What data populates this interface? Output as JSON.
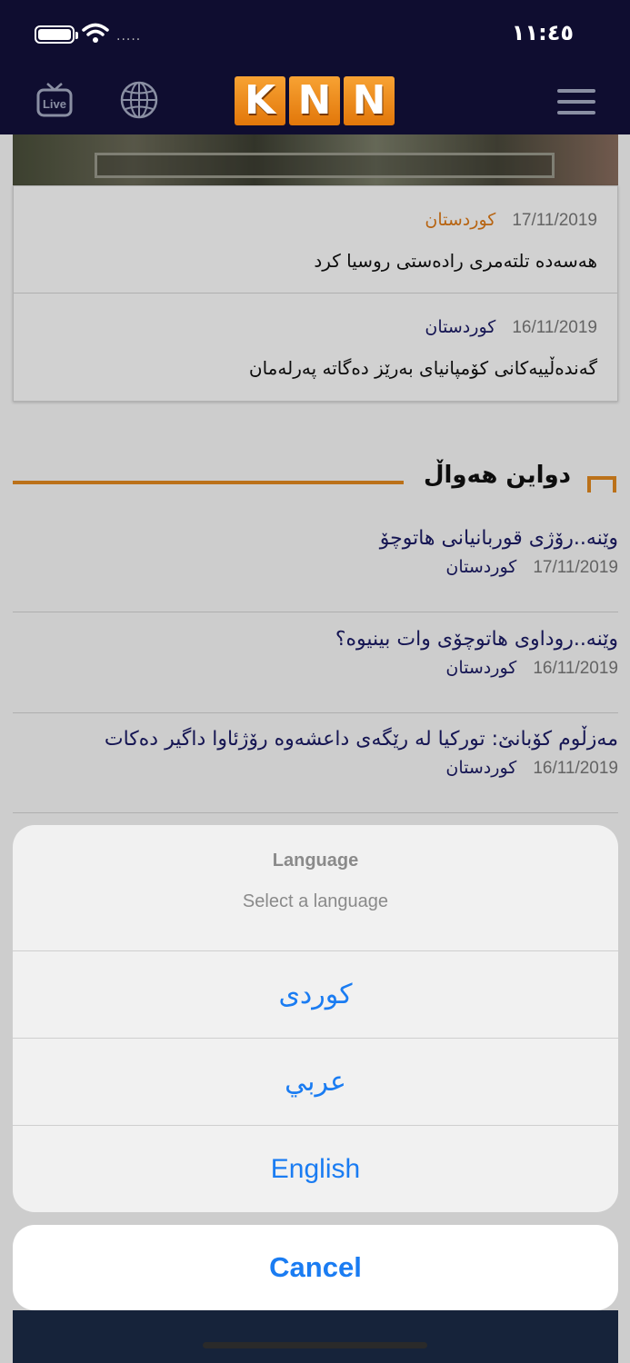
{
  "status_bar": {
    "time": "١١:٤٥",
    "signal_dots": "....."
  },
  "nav": {
    "logo_letters": [
      "K",
      "N",
      "N"
    ],
    "live_icon": "tv-live-icon",
    "globe_icon": "globe-icon",
    "menu_icon": "hamburger-menu-icon"
  },
  "top_card": {
    "items": [
      {
        "category": "كوردستان",
        "category_color": "#e07b16",
        "date": "17/11/2019",
        "headline": "هەسەدە تلتەمری رادەستی روسیا کرد"
      },
      {
        "category": "كوردستان",
        "category_color": "#1b1b66",
        "date": "16/11/2019",
        "headline": "گەندەڵییەکانی کۆمپانیای بەرێز دەگاتە پەرلەمان"
      }
    ]
  },
  "latest_news": {
    "title": "دواین هەواڵ",
    "accent_color": "#e58a1f",
    "items": [
      {
        "headline": "وێنە..رۆژی قوربانیانی هاتوچۆ",
        "category": "كوردستان",
        "date": "17/11/2019"
      },
      {
        "headline": "وێنە..روداوی هاتوچۆی وات بينيوە؟",
        "category": "كوردستان",
        "date": "16/11/2019"
      },
      {
        "headline": "مەزڵوم کۆبانێ: تورکیا لە رێگەی داعشەوە رۆژئاوا داگیر دەکات",
        "category": "كوردستان",
        "date": "16/11/2019"
      }
    ]
  },
  "action_sheet": {
    "title": "Language",
    "message": "Select a language",
    "options": [
      "كوردى",
      "عربي",
      "English"
    ],
    "cancel_label": "Cancel",
    "accent_color": "#1a7cf2"
  }
}
